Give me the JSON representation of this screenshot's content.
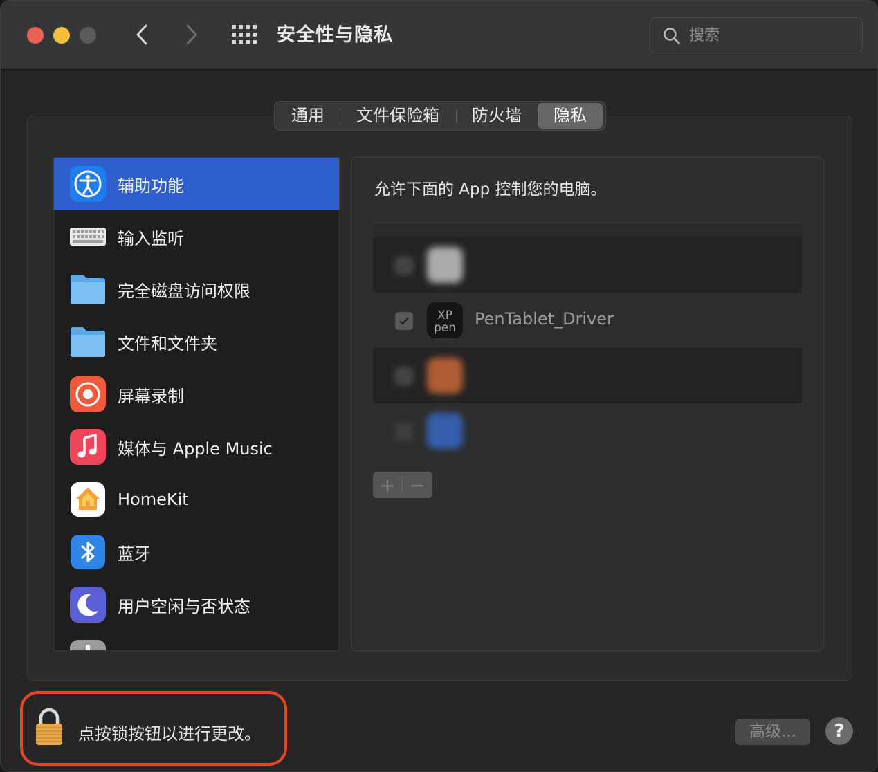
{
  "window": {
    "title": "安全性与隐私",
    "search": {
      "placeholder": "搜索",
      "value": ""
    }
  },
  "tabs": [
    {
      "label": "通用",
      "active": false
    },
    {
      "label": "文件保险箱",
      "active": false
    },
    {
      "label": "防火墙",
      "active": false
    },
    {
      "label": "隐私",
      "active": true
    }
  ],
  "sidebar": {
    "items": [
      {
        "label": "辅助功能",
        "icon": "accessibility-icon",
        "selected": true
      },
      {
        "label": "输入监听",
        "icon": "keyboard-icon",
        "selected": false
      },
      {
        "label": "完全磁盘访问权限",
        "icon": "folder-icon",
        "selected": false
      },
      {
        "label": "文件和文件夹",
        "icon": "folder-icon",
        "selected": false
      },
      {
        "label": "屏幕录制",
        "icon": "screen-recording-icon",
        "selected": false
      },
      {
        "label": "媒体与 Apple Music",
        "icon": "music-icon",
        "selected": false
      },
      {
        "label": "HomeKit",
        "icon": "homekit-icon",
        "selected": false
      },
      {
        "label": "蓝牙",
        "icon": "bluetooth-icon",
        "selected": false
      },
      {
        "label": "用户空闲与否状态",
        "icon": "moon-icon",
        "selected": false
      }
    ]
  },
  "pane": {
    "description": "允许下面的 App 控制您的电脑。",
    "apps": [
      {
        "name": "",
        "checked": true,
        "blurred": true
      },
      {
        "name": "PenTablet_Driver",
        "checked": true,
        "blurred": false,
        "icon_text_top": "XP",
        "icon_text_bottom": "pen"
      },
      {
        "name": "",
        "checked": true,
        "blurred": true
      },
      {
        "name": "",
        "checked": false,
        "blurred": true
      }
    ],
    "add_label": "+",
    "remove_label": "−"
  },
  "footer": {
    "lock_text": "点按锁按钮以进行更改。",
    "advanced_label": "高级...",
    "help_label": "?"
  },
  "colors": {
    "selected": "#2f5fcf",
    "highlight_border": "#e64628",
    "close": "#ec5f56",
    "minimize": "#f4be3c"
  }
}
